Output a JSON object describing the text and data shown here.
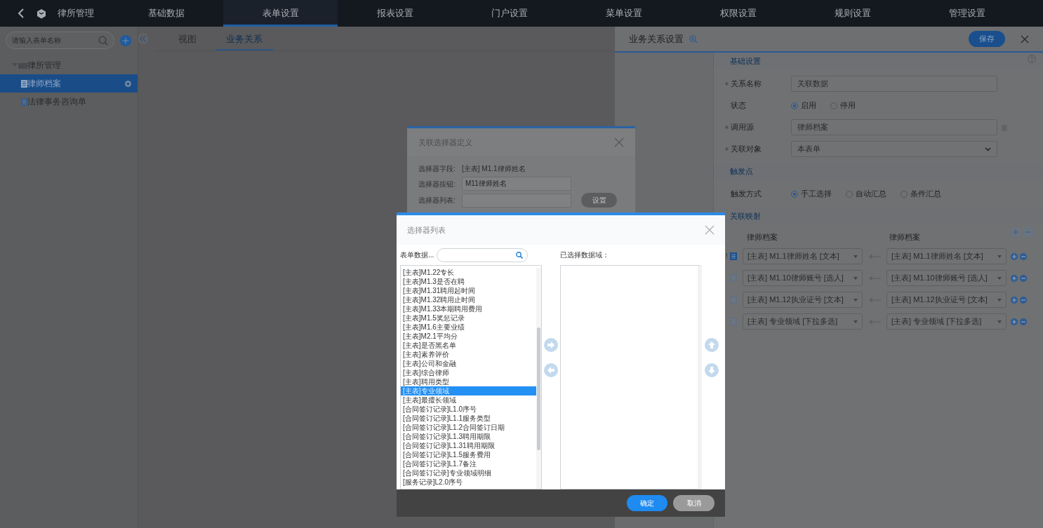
{
  "top_nav": {
    "app_title": "律所管理",
    "tabs": [
      {
        "label": "基础数据",
        "selected": false
      },
      {
        "label": "表单设置",
        "selected": true
      },
      {
        "label": "报表设置",
        "selected": false
      },
      {
        "label": "门户设置",
        "selected": false
      },
      {
        "label": "菜单设置",
        "selected": false
      },
      {
        "label": "权限设置",
        "selected": false
      },
      {
        "label": "规则设置",
        "selected": false
      },
      {
        "label": "管理设置",
        "selected": false
      }
    ]
  },
  "sidebar": {
    "search_placeholder": "请输入表单名称",
    "tree": [
      {
        "label": "律所管理",
        "expanded": true,
        "children": [
          {
            "label": "律师档案",
            "selected": true
          },
          {
            "label": "法律事务咨询单",
            "selected": false
          }
        ]
      }
    ]
  },
  "content_tabs": [
    {
      "label": "视图",
      "selected": false
    },
    {
      "label": "业务关系",
      "selected": true
    }
  ],
  "settings_panel": {
    "title": "业务关系设置",
    "save_button": "保存",
    "basic": {
      "heading": "基础设置",
      "fields": [
        {
          "kind": "input",
          "label": "关系名称",
          "required": true,
          "value": "关联数据"
        },
        {
          "kind": "radio",
          "label": "状态",
          "required": false,
          "options": [
            {
              "label": "启用",
              "selected": true
            },
            {
              "label": "停用",
              "selected": false
            }
          ]
        },
        {
          "kind": "input",
          "label": "调用源",
          "required": true,
          "value": "律师档案",
          "deletable": true
        },
        {
          "kind": "select",
          "label": "关联对象",
          "required": true,
          "value": "本表单"
        }
      ]
    },
    "trigger": {
      "heading": "触发点",
      "fields": [
        {
          "kind": "radio",
          "label": "触发方式",
          "required": false,
          "options": [
            {
              "label": "手工选择",
              "selected": true
            },
            {
              "label": "自动汇总",
              "selected": false
            },
            {
              "label": "条件汇总",
              "selected": false
            }
          ]
        }
      ]
    },
    "mapping": {
      "heading": "关联映射",
      "left_header": "律师档案",
      "right_header": "律师档案",
      "rows": [
        {
          "marker": "!",
          "selected": true,
          "left": "[主表] M1.1律师姓名 [文本]",
          "right": "[主表] M1.1律师姓名 [文本]"
        },
        {
          "selected": false,
          "left": "[主表] M1.10律师账号 [选人]",
          "right": "[主表] M1.10律师账号 [选人]"
        },
        {
          "selected": false,
          "left": "[主表] M1.12执业证号 [文本]",
          "right": "[主表] M1.12执业证号 [文本]"
        },
        {
          "selected": false,
          "left": "[主表] 专业领域 [下拉多选]",
          "right": "[主表] 专业领域 [下拉多选]"
        }
      ]
    }
  },
  "selector_definition_dialog": {
    "title": "关联选择器定义",
    "field_label": "选择器字段:",
    "field_value": "[主表] M1.1律师姓名",
    "button_label": "选择器按钮:",
    "button_value": "M11律师姓名",
    "list_label": "选择器列表:",
    "set_button": "设置"
  },
  "selector_list_dialog": {
    "title": "选择器列表",
    "source_label": "表单数据...",
    "selected_label": "已选择数据域：",
    "items": [
      {
        "label": "[主表]M1.22专长",
        "selected": false
      },
      {
        "label": "[主表]M1.3是否在聘",
        "selected": false
      },
      {
        "label": "[主表]M1.31聘用起时间",
        "selected": false
      },
      {
        "label": "[主表]M1.32聘用止时间",
        "selected": false
      },
      {
        "label": "[主表]M1.33本期聘用费用",
        "selected": false
      },
      {
        "label": "[主表]M1.5奖惩记录",
        "selected": false
      },
      {
        "label": "[主表]M1.6主要业绩",
        "selected": false
      },
      {
        "label": "[主表]M2.1平均分",
        "selected": false
      },
      {
        "label": "[主表]是否黑名单",
        "selected": false
      },
      {
        "label": "[主表]素养评价",
        "selected": false
      },
      {
        "label": "[主表]公司和金融",
        "selected": false
      },
      {
        "label": "[主表]综合律师",
        "selected": false
      },
      {
        "label": "[主表]聘用类型",
        "selected": false
      },
      {
        "label": "[主表]专业领域",
        "selected": true
      },
      {
        "label": "[主表]最擅长领域",
        "selected": false
      },
      {
        "label": "[合同签订记录]L1.0序号",
        "selected": false
      },
      {
        "label": "[合同签订记录]L1.1服务类型",
        "selected": false
      },
      {
        "label": "[合同签订记录]L1.2合同签订日期",
        "selected": false
      },
      {
        "label": "[合同签订记录]L1.3聘用期限",
        "selected": false
      },
      {
        "label": "[合同签订记录]L1.31聘用期限",
        "selected": false
      },
      {
        "label": "[合同签订记录]L1.5服务费用",
        "selected": false
      },
      {
        "label": "[合同签订记录]L1.7备注",
        "selected": false
      },
      {
        "label": "[合同签订记录]专业领域明细",
        "selected": false
      },
      {
        "label": "[服务记录]L2.0序号",
        "selected": false
      }
    ],
    "ok_button": "确定",
    "cancel_button": "取消"
  }
}
